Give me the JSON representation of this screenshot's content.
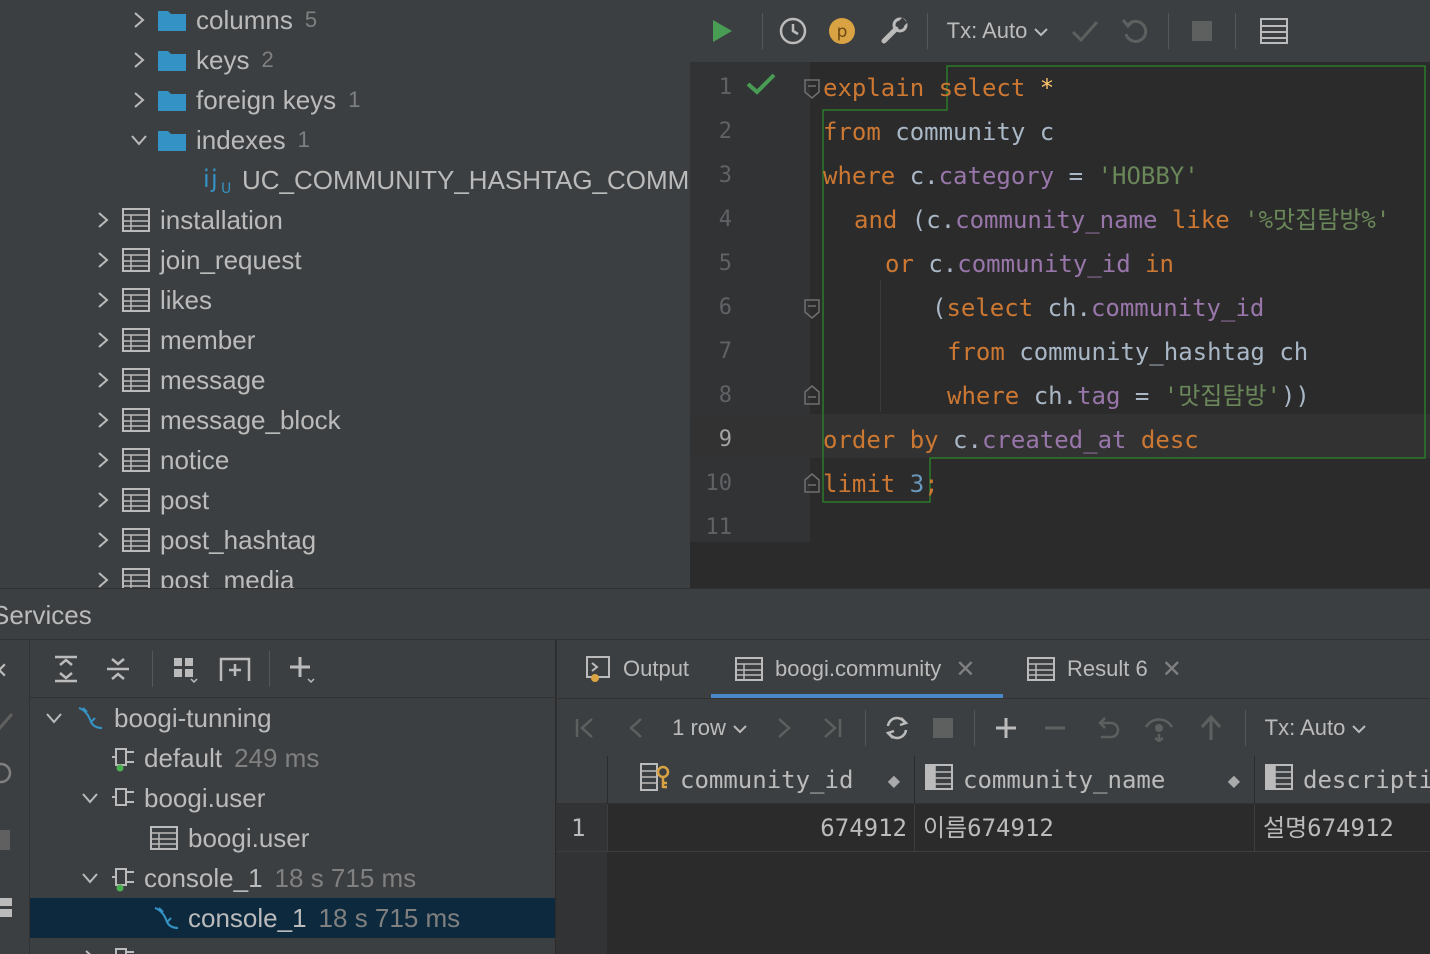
{
  "db_tree": {
    "rows": [
      {
        "label": "columns",
        "count": "5"
      },
      {
        "label": "keys",
        "count": "2"
      },
      {
        "label": "foreign keys",
        "count": "1"
      },
      {
        "label": "indexes",
        "count": "1"
      },
      {
        "label": "UC_COMMUNITY_HASHTAG_COMMUNITY_ID_TAG"
      },
      {
        "label": "installation"
      },
      {
        "label": "join_request"
      },
      {
        "label": "likes"
      },
      {
        "label": "member"
      },
      {
        "label": "message"
      },
      {
        "label": "message_block"
      },
      {
        "label": "notice"
      },
      {
        "label": "post"
      },
      {
        "label": "post_hashtag"
      },
      {
        "label": "post_media"
      }
    ]
  },
  "editor": {
    "toolbar": {
      "tx_mode": "Tx: Auto",
      "profile_letter": "p",
      "icons": [
        "run-icon",
        "history-icon",
        "profile-icon",
        "settings-wrench-icon",
        "commit-icon",
        "rollback-icon",
        "stop-icon",
        "output-table-icon"
      ]
    },
    "line_numbers": [
      "1",
      "2",
      "3",
      "4",
      "5",
      "6",
      "7",
      "8",
      "9",
      "10",
      "11"
    ],
    "current_line": "9",
    "code": {
      "l1": {
        "kw1": "explain",
        "kw2": "select",
        "star": "*"
      },
      "l2": {
        "kw": "from",
        "rest": " community c"
      },
      "l3": {
        "kw": "where",
        "pre": " c.",
        "fld": "category",
        "op": " = ",
        "str": "'HOBBY'"
      },
      "l4": {
        "kw": "and",
        "pre": " (c.",
        "fld": "community_name",
        "kw2": " like ",
        "str": "'%맛집탐방%'"
      },
      "l5": {
        "kw": "or",
        "pre": " c.",
        "fld": "community_id",
        "kw2": " in"
      },
      "l6": {
        "pre": "(",
        "kw": "select",
        "mid": " ch.",
        "fld": "community_id"
      },
      "l7": {
        "kw": "from",
        "rest": " community_hashtag ch"
      },
      "l8": {
        "kw": "where",
        "pre": " ch.",
        "fld": "tag",
        "op": " = ",
        "str": "'맛집탐방'",
        "post": "))"
      },
      "l9": {
        "kw1": "order",
        "kw2": " by",
        "pre": " c.",
        "fld": "created_at",
        "kw3": " desc"
      },
      "l10": {
        "kw": "limit",
        "sp": " ",
        "num": "3",
        "semi": ";"
      }
    }
  },
  "services": {
    "title": "Services",
    "tree": [
      {
        "label": "boogi-tunning",
        "time": ""
      },
      {
        "label": "default",
        "time": "249 ms"
      },
      {
        "label": "boogi.user",
        "time": ""
      },
      {
        "label": "boogi.user",
        "time": ""
      },
      {
        "label": "console_1",
        "time": "18 s 715 ms"
      },
      {
        "label": "console_1",
        "time": "18 s 715 ms"
      }
    ]
  },
  "results": {
    "tabs": [
      {
        "label": "Output"
      },
      {
        "label": "boogi.community"
      },
      {
        "label": "Result 6"
      }
    ],
    "toolbar": {
      "rows": "1 row",
      "tx_mode": "Tx: Auto"
    },
    "columns": [
      "community_id",
      "community_name",
      "description"
    ],
    "rows": [
      {
        "num": "1",
        "community_id": "674912",
        "community_name": "이름674912",
        "description": "설명674912"
      }
    ]
  },
  "colors": {
    "background": "#2b2b2b",
    "panel": "#3c3f41",
    "keyword": "#cc7832",
    "field": "#9876aa",
    "string": "#6a8759",
    "number": "#6897bb",
    "selection": "#0d293e",
    "accent": "#4a88c7",
    "run_green": "#499c54"
  }
}
